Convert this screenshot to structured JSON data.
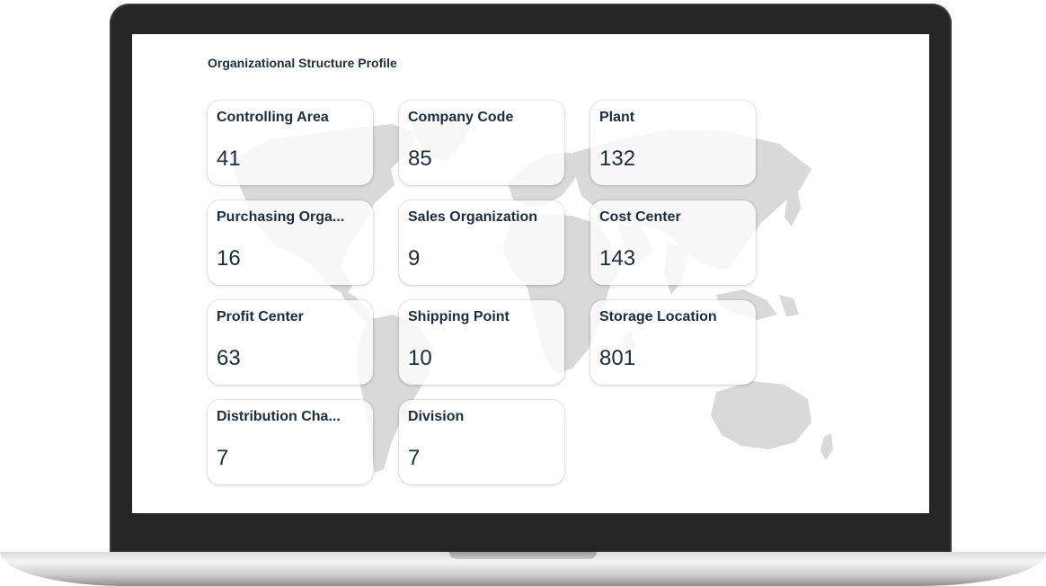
{
  "page": {
    "title": "Organizational Structure Profile"
  },
  "colors": {
    "text": "#1d2d3e",
    "map": "#d9d9d9",
    "bezel": "#262626"
  },
  "tiles": [
    {
      "label": "Controlling Area",
      "value": "41"
    },
    {
      "label": "Company Code",
      "value": "85"
    },
    {
      "label": "Plant",
      "value": "132"
    },
    {
      "label": "Purchasing Orga...",
      "value": "16"
    },
    {
      "label": "Sales Organization",
      "value": "9"
    },
    {
      "label": "Cost Center",
      "value": "143"
    },
    {
      "label": "Profit Center",
      "value": "63"
    },
    {
      "label": "Shipping Point",
      "value": "10"
    },
    {
      "label": "Storage Location",
      "value": "801"
    },
    {
      "label": "Distribution Cha...",
      "value": "7"
    },
    {
      "label": "Division",
      "value": "7"
    }
  ]
}
